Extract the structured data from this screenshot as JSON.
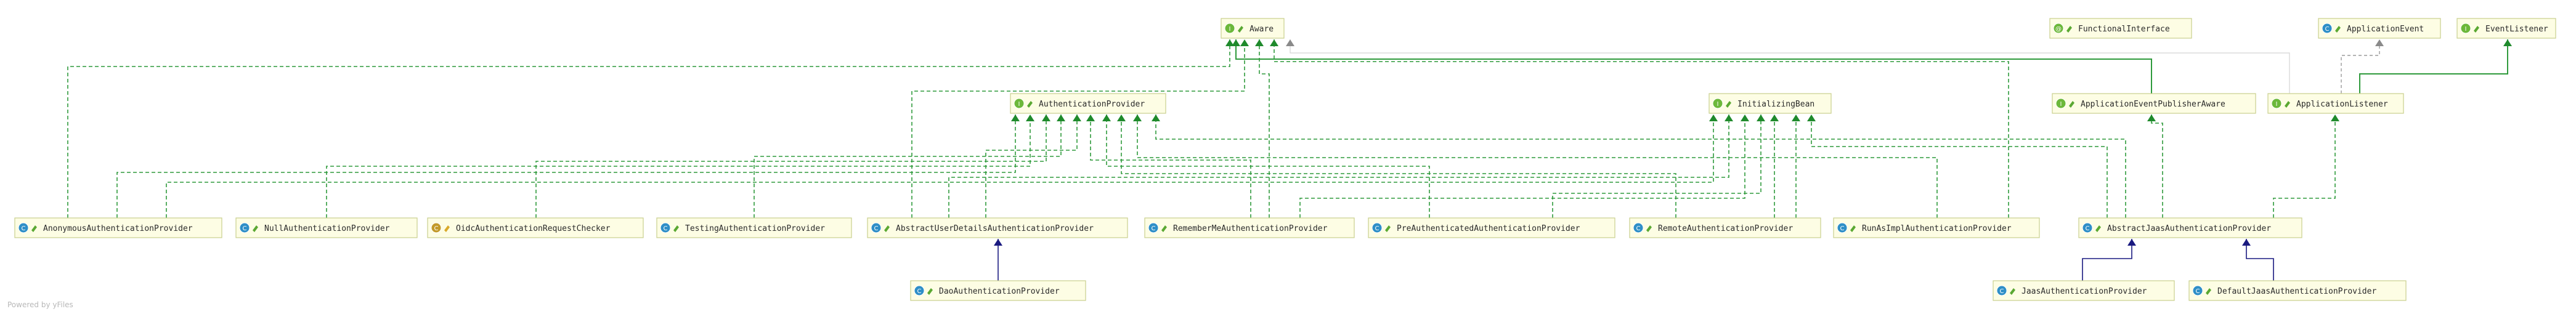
{
  "nodes": [
    {
      "id": "aware",
      "label": "Aware",
      "kind": "interface"
    },
    {
      "id": "functional_interface",
      "label": "FunctionalInterface",
      "kind": "annotation"
    },
    {
      "id": "application_event",
      "label": "ApplicationEvent",
      "kind": "class"
    },
    {
      "id": "event_listener",
      "label": "EventListener",
      "kind": "interface"
    },
    {
      "id": "authentication_provider",
      "label": "AuthenticationProvider",
      "kind": "interface"
    },
    {
      "id": "initializing_bean",
      "label": "InitializingBean",
      "kind": "interface"
    },
    {
      "id": "application_event_publisher_aware",
      "label": "ApplicationEventPublisherAware",
      "kind": "interface"
    },
    {
      "id": "application_listener",
      "label": "ApplicationListener",
      "kind": "interface"
    },
    {
      "id": "anonymous_authentication_provider",
      "label": "AnonymousAuthenticationProvider",
      "kind": "class"
    },
    {
      "id": "null_authentication_provider",
      "label": "NullAuthenticationProvider",
      "kind": "class"
    },
    {
      "id": "oidc_authentication_request_checker",
      "label": "OidcAuthenticationRequestChecker",
      "kind": "class-final"
    },
    {
      "id": "testing_authentication_provider",
      "label": "TestingAuthenticationProvider",
      "kind": "class"
    },
    {
      "id": "abstract_user_details_authentication_provider",
      "label": "AbstractUserDetailsAuthenticationProvider",
      "kind": "abstract"
    },
    {
      "id": "remember_me_authentication_provider",
      "label": "RememberMeAuthenticationProvider",
      "kind": "class"
    },
    {
      "id": "pre_authenticated_authentication_provider",
      "label": "PreAuthenticatedAuthenticationProvider",
      "kind": "class"
    },
    {
      "id": "remote_authentication_provider",
      "label": "RemoteAuthenticationProvider",
      "kind": "class"
    },
    {
      "id": "run_as_impl_authentication_provider",
      "label": "RunAsImplAuthenticationProvider",
      "kind": "class"
    },
    {
      "id": "abstract_jaas_authentication_provider",
      "label": "AbstractJaasAuthenticationProvider",
      "kind": "abstract"
    },
    {
      "id": "dao_authentication_provider",
      "label": "DaoAuthenticationProvider",
      "kind": "class"
    },
    {
      "id": "jaas_authentication_provider",
      "label": "JaasAuthenticationProvider",
      "kind": "class"
    },
    {
      "id": "default_jaas_authentication_provider",
      "label": "DefaultJaasAuthenticationProvider",
      "kind": "class"
    }
  ],
  "edges": [
    {
      "from": "anonymous_authentication_provider",
      "to": "aware",
      "type": "implements"
    },
    {
      "from": "anonymous_authentication_provider",
      "to": "authentication_provider",
      "type": "implements"
    },
    {
      "from": "anonymous_authentication_provider",
      "to": "initializing_bean",
      "type": "implements"
    },
    {
      "from": "null_authentication_provider",
      "to": "authentication_provider",
      "type": "implements"
    },
    {
      "from": "oidc_authentication_request_checker",
      "to": "authentication_provider",
      "type": "implements"
    },
    {
      "from": "testing_authentication_provider",
      "to": "authentication_provider",
      "type": "implements"
    },
    {
      "from": "abstract_user_details_authentication_provider",
      "to": "authentication_provider",
      "type": "implements"
    },
    {
      "from": "abstract_user_details_authentication_provider",
      "to": "aware",
      "type": "implements"
    },
    {
      "from": "abstract_user_details_authentication_provider",
      "to": "initializing_bean",
      "type": "implements"
    },
    {
      "from": "remember_me_authentication_provider",
      "to": "authentication_provider",
      "type": "implements"
    },
    {
      "from": "remember_me_authentication_provider",
      "to": "aware",
      "type": "implements"
    },
    {
      "from": "remember_me_authentication_provider",
      "to": "initializing_bean",
      "type": "implements"
    },
    {
      "from": "pre_authenticated_authentication_provider",
      "to": "authentication_provider",
      "type": "implements"
    },
    {
      "from": "pre_authenticated_authentication_provider",
      "to": "initializing_bean",
      "type": "implements"
    },
    {
      "from": "remote_authentication_provider",
      "to": "authentication_provider",
      "type": "implements"
    },
    {
      "from": "remote_authentication_provider",
      "to": "initializing_bean",
      "type": "implements"
    },
    {
      "from": "run_as_impl_authentication_provider",
      "to": "authentication_provider",
      "type": "implements"
    },
    {
      "from": "run_as_impl_authentication_provider",
      "to": "aware",
      "type": "implements"
    },
    {
      "from": "run_as_impl_authentication_provider",
      "to": "initializing_bean",
      "type": "implements"
    },
    {
      "from": "abstract_jaas_authentication_provider",
      "to": "authentication_provider",
      "type": "implements"
    },
    {
      "from": "abstract_jaas_authentication_provider",
      "to": "application_event_publisher_aware",
      "type": "implements"
    },
    {
      "from": "abstract_jaas_authentication_provider",
      "to": "application_listener",
      "type": "implements"
    },
    {
      "from": "abstract_jaas_authentication_provider",
      "to": "initializing_bean",
      "type": "implements"
    },
    {
      "from": "application_event_publisher_aware",
      "to": "aware",
      "type": "extends"
    },
    {
      "from": "application_listener",
      "to": "event_listener",
      "type": "extends"
    },
    {
      "from": "application_listener",
      "to": "application_event",
      "type": "uses"
    },
    {
      "from": "application_listener",
      "to": "functional_interface",
      "type": "annotated"
    },
    {
      "from": "dao_authentication_provider",
      "to": "abstract_user_details_authentication_provider",
      "type": "extends-class"
    },
    {
      "from": "jaas_authentication_provider",
      "to": "abstract_jaas_authentication_provider",
      "type": "extends-class"
    },
    {
      "from": "default_jaas_authentication_provider",
      "to": "abstract_jaas_authentication_provider",
      "type": "extends-class"
    }
  ],
  "colors": {
    "interface_icon": "#6cb83a",
    "class_icon": "#2f8fc7",
    "final_icon": "#c39a2a",
    "implements_edge": "#2f9a3c",
    "extends_class_edge": "#1a1a80",
    "node_fill": "#fdfde4",
    "node_border": "#c9cf8e"
  },
  "footer": "Powered by yFiles"
}
